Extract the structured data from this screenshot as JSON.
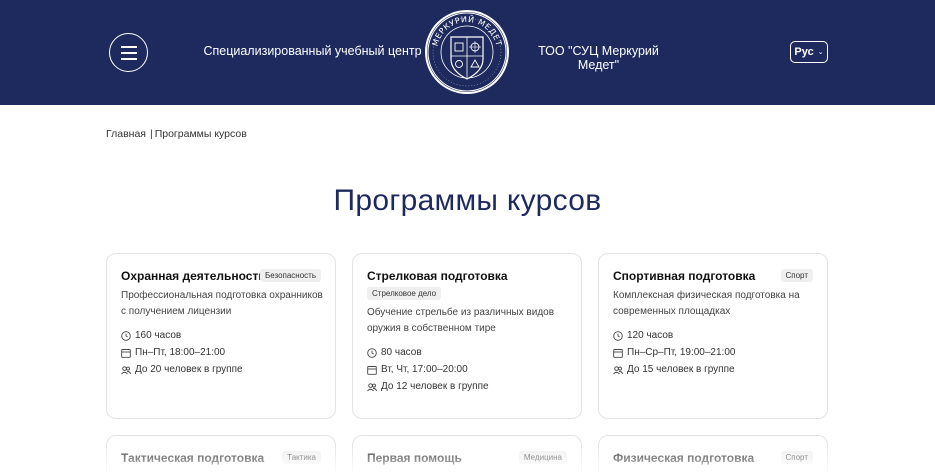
{
  "header": {
    "left_text": "Специализированный учебный центр",
    "right_text": "ТОО \"СУЦ Меркурий Медет\"",
    "logo_text": "МЕРКУРИЙ МЕДЕТ",
    "lang": "Рус"
  },
  "breadcrumb": {
    "home": "Главная",
    "separator": "|",
    "current": "Программы курсов"
  },
  "page_title": "Программы курсов",
  "cards": [
    {
      "title": "Охранная деятельность",
      "tag": "Безопасность",
      "desc": "Профессиональная подготовка охранников с получением лицензии",
      "hours": "160 часов",
      "schedule": "Пн–Пт, 18:00–21:00",
      "group": "До 20 человек в группе"
    },
    {
      "title": "Стрелковая подготовка",
      "tag": "Стрелковое дело",
      "desc": "Обучение стрельбе из различных видов оружия в собственном тире",
      "hours": "80 часов",
      "schedule": "Вт, Чт, 17:00–20:00",
      "group": "До 12 человек в группе"
    },
    {
      "title": "Спортивная подготовка",
      "tag": "Спорт",
      "desc": "Комплексная физическая подготовка на современных площадках",
      "hours": "120 часов",
      "schedule": "Пн–Ср–Пт, 19:00–21:00",
      "group": "До 15 человек в группе"
    },
    {
      "title": "Тактическая подготовка",
      "tag": "Тактика"
    },
    {
      "title": "Первая помощь",
      "tag": "Медицина"
    },
    {
      "title": "Физическая подготовка",
      "tag": "Спорт"
    }
  ]
}
